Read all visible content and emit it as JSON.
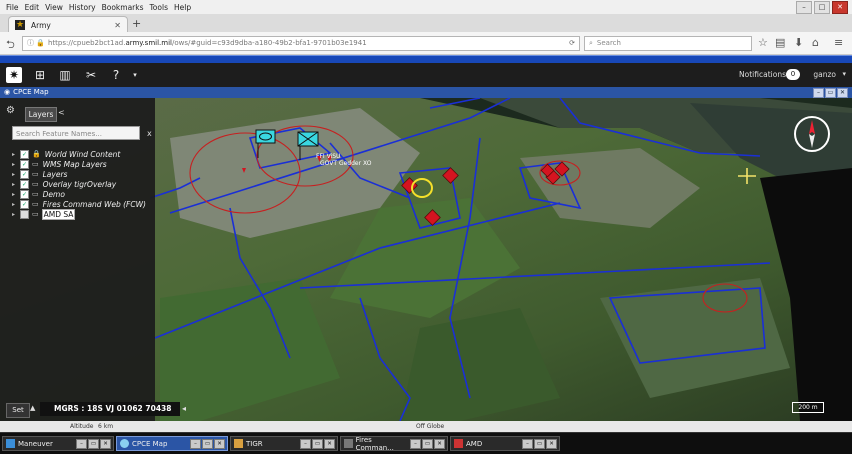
{
  "browser": {
    "menu": [
      "File",
      "Edit",
      "View",
      "History",
      "Bookmarks",
      "Tools",
      "Help"
    ],
    "tab_title": "Army",
    "url_prefix": "https://cpueb2bct1ad.",
    "url_host": "army.smil.mil",
    "url_rest": "/ows/#guid=c93d9dba-a180-49b2-bfa1-9701b03e1941",
    "search_placeholder": "Search"
  },
  "app": {
    "notifications_label": "Notifications",
    "notifications_count": "0",
    "user": "ganzo"
  },
  "window": {
    "title": "CPCE Map"
  },
  "panel": {
    "layers_button": "Layers",
    "collapse": "<",
    "search_placeholder": "Search Feature Names...",
    "search_close": "x",
    "layers": [
      {
        "label": "World Wind Content",
        "checked": true,
        "locked": true
      },
      {
        "label": "WMS Map Layers",
        "checked": true,
        "locked": false
      },
      {
        "label": "Layers",
        "checked": true,
        "locked": false
      },
      {
        "label": "Overlay tigrOverlay",
        "checked": true,
        "locked": false
      },
      {
        "label": "Demo",
        "checked": true,
        "locked": false
      },
      {
        "label": "Fires Command Web (FCW)",
        "checked": true,
        "locked": false
      },
      {
        "label": "AMD SA",
        "checked": false,
        "locked": false,
        "selected": true
      }
    ]
  },
  "map": {
    "set_button": "Set",
    "mgrs": "MGRS : 18S VJ 01062 70438",
    "scale": "200 m",
    "labels": [
      "FFI ViSU",
      "GOVT Gedder XO"
    ],
    "colors": {
      "boundary": "#1a2fd6",
      "hostile": "#d41420",
      "friendly": "#3ad7e0",
      "range_ring": "#c62020"
    }
  },
  "status": {
    "altitude_label": "Altitude",
    "altitude_value": "6 km",
    "globe": "Off Globe"
  },
  "taskbar": [
    {
      "label": "Maneuver",
      "active": false
    },
    {
      "label": "CPCE Map",
      "active": true
    },
    {
      "label": "TIGR",
      "active": false
    },
    {
      "label": "Fires Comman...",
      "active": false
    },
    {
      "label": "AMD",
      "active": false
    }
  ]
}
